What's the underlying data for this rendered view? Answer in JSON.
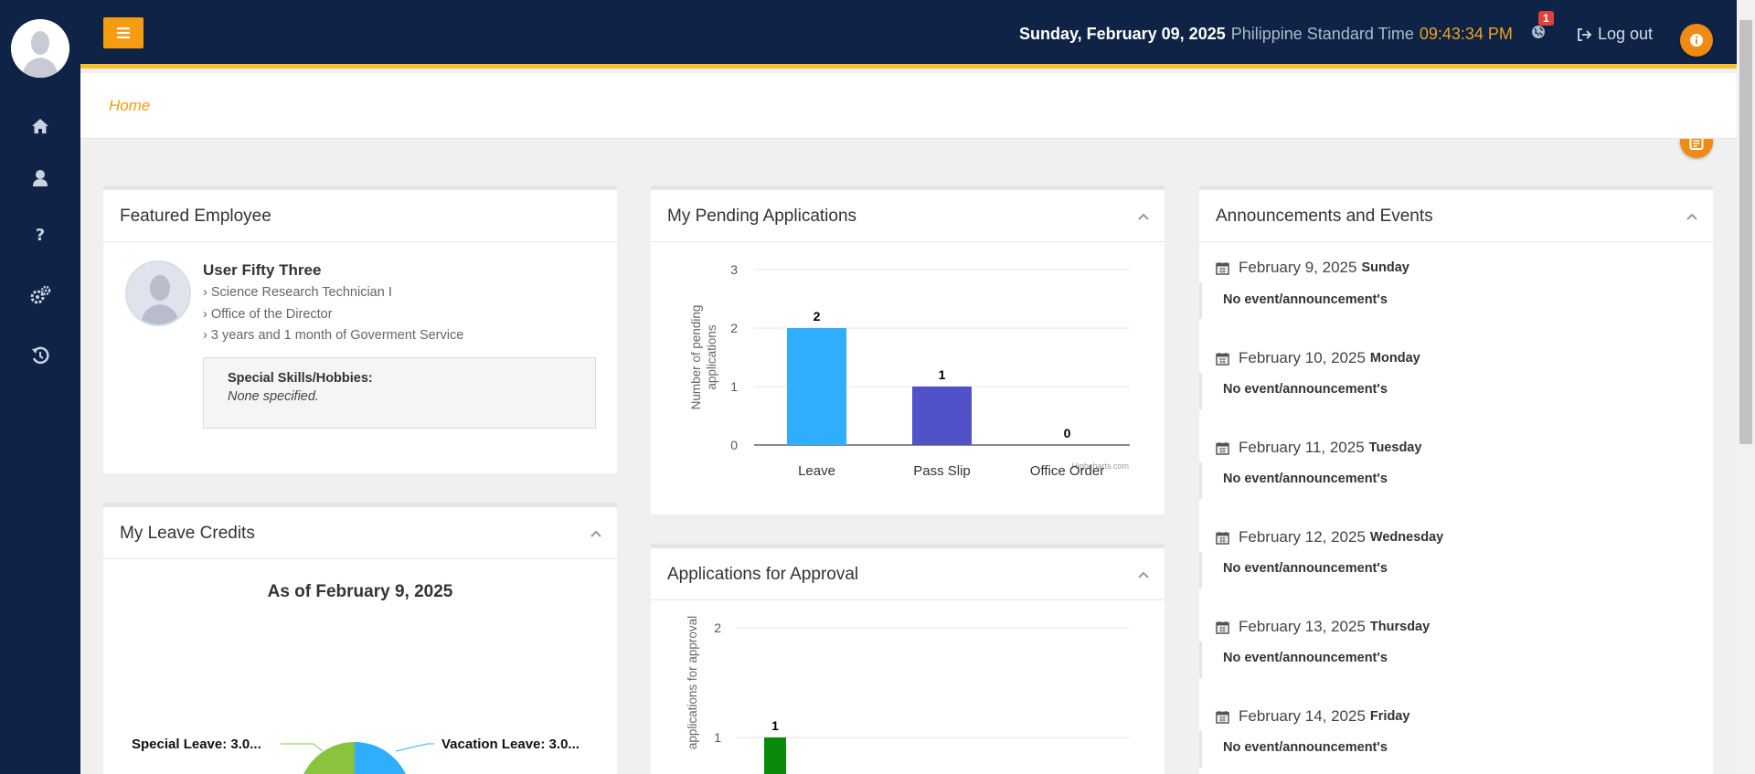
{
  "topbar": {
    "date": "Sunday, February 09, 2025",
    "timezone": "Philippine Standard Time",
    "time": "09:43:34 PM",
    "notification_count": "1",
    "logout_label": "Log out"
  },
  "breadcrumb": {
    "home": "Home"
  },
  "featured": {
    "title": "Featured Employee",
    "name": "User Fifty Three",
    "position": "Science Research Technician I",
    "office": "Office of the Director",
    "service": "3 years and 1 month of Goverment Service",
    "skills_label": "Special Skills/Hobbies:",
    "skills_value": "None specified."
  },
  "leave": {
    "title": "My Leave Credits",
    "chart_title": "As of February 9, 2025",
    "label_special": "Special Leave: 3.0...",
    "label_vacation": "Vacation Leave: 3.0..."
  },
  "pending": {
    "title": "My Pending Applications",
    "credit": "Highcharts.com"
  },
  "approval": {
    "title": "Applications for Approval"
  },
  "announcements": {
    "title": "Announcements and Events",
    "items": [
      {
        "date": "February 9, 2025",
        "dow": "Sunday",
        "note": "No event/announcement's"
      },
      {
        "date": "February 10, 2025",
        "dow": "Monday",
        "note": "No event/announcement's"
      },
      {
        "date": "February 11, 2025",
        "dow": "Tuesday",
        "note": "No event/announcement's"
      },
      {
        "date": "February 12, 2025",
        "dow": "Wednesday",
        "note": "No event/announcement's"
      },
      {
        "date": "February 13, 2025",
        "dow": "Thursday",
        "note": "No event/announcement's"
      },
      {
        "date": "February 14, 2025",
        "dow": "Friday",
        "note": "No event/announcement's"
      }
    ]
  },
  "colors": {
    "navy": "#0e2346",
    "accent": "#f59c10",
    "gold": "#f6c02b"
  },
  "chart_data": [
    {
      "type": "bar",
      "categories": [
        "Leave",
        "Pass Slip",
        "Office Order"
      ],
      "values": [
        2,
        1,
        0
      ],
      "colors": [
        "#2eaefc",
        "#5252c8",
        "#2f2f80"
      ],
      "ylabel": "Number of pending applications",
      "ylim": [
        0,
        3
      ],
      "yticks": [
        0,
        1,
        2,
        3
      ],
      "grid": true
    },
    {
      "type": "bar",
      "values": [
        1
      ],
      "colors": [
        "#0a8a0a"
      ],
      "ylabel": "applications for approval",
      "yticks": [
        1,
        2
      ],
      "grid": true
    },
    {
      "type": "pie",
      "title": "As of February 9, 2025",
      "slices": [
        {
          "name": "Special Leave",
          "label": "Special Leave: 3.0...",
          "color": "#8ac43f"
        },
        {
          "name": "Vacation Leave",
          "label": "Vacation Leave: 3.0...",
          "color": "#2eaefc"
        }
      ]
    }
  ]
}
